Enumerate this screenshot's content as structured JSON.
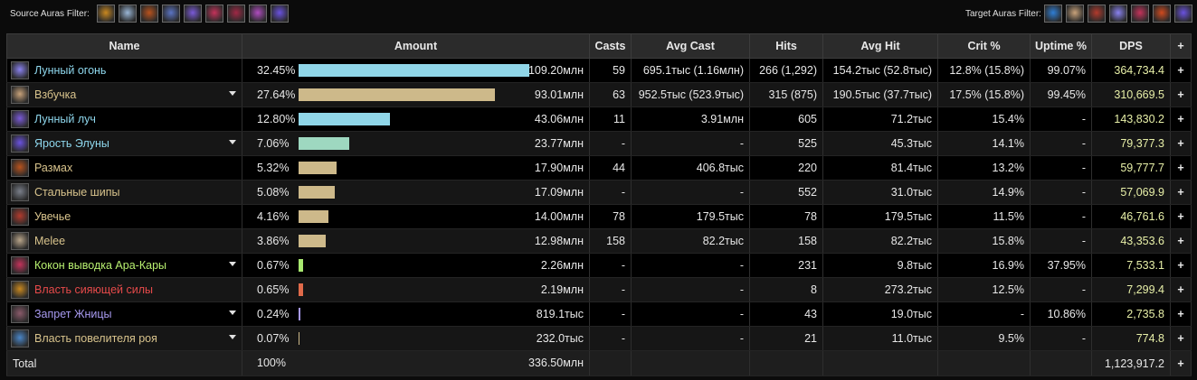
{
  "source_filter": {
    "label": "Source Auras Filter:",
    "icons": [
      {
        "name": "radiant-sun-icon",
        "color": "#c9881f"
      },
      {
        "name": "spirit-face-icon",
        "color": "#9ab6d6"
      },
      {
        "name": "fire-claw-icon",
        "color": "#b8521d"
      },
      {
        "name": "moon-scythe-icon",
        "color": "#5b74c4"
      },
      {
        "name": "purple-beam-icon",
        "color": "#7a5ad8"
      },
      {
        "name": "crimson-flower-icon",
        "color": "#c4325a"
      },
      {
        "name": "crimson-rune-icon",
        "color": "#a02845"
      },
      {
        "name": "violet-orb-icon",
        "color": "#b04cc0"
      },
      {
        "name": "arcane-star-icon",
        "color": "#6a52e0"
      }
    ]
  },
  "target_filter": {
    "label": "Target Auras Filter:",
    "icons": [
      {
        "name": "blue-eye-icon",
        "color": "#2f7fd6"
      },
      {
        "name": "feral-roar-icon",
        "color": "#c8a27a"
      },
      {
        "name": "red-blade-icon",
        "color": "#b23a2c"
      },
      {
        "name": "moonfire-icon",
        "color": "#8a82f0"
      },
      {
        "name": "crimson-flower-icon",
        "color": "#c4325a"
      },
      {
        "name": "demon-mask-icon",
        "color": "#d04a1e"
      },
      {
        "name": "arcane-star-icon",
        "color": "#6a52e0"
      }
    ]
  },
  "headers": {
    "name": "Name",
    "amount": "Amount",
    "casts": "Casts",
    "avg_cast": "Avg Cast",
    "hits": "Hits",
    "avg_hit": "Avg Hit",
    "crit": "Crit %",
    "uptime": "Uptime %",
    "dps": "DPS",
    "plus": "+"
  },
  "max_amount_mln": 109.2,
  "rows": [
    {
      "icon": "moonfire-icon",
      "icon_color": "#8a82f0",
      "name": "Лунный огонь",
      "name_color": "#8fd8ee",
      "expandable": false,
      "percent": "32.45%",
      "amount": "109.20млн",
      "amount_mln": 109.2,
      "bar_color": "#90d6e8",
      "casts": "59",
      "avg_cast": "695.1тыс (1.16млн)",
      "hits": "266 (1,292)",
      "avg_hit": "154.2тыс (52.8тыс)",
      "crit": "12.8% (15.8%)",
      "uptime": "99.07%",
      "dps": "364,734.4",
      "plus": "+"
    },
    {
      "icon": "feral-roar-icon",
      "icon_color": "#c8a27a",
      "name": "Взбучка",
      "name_color": "#d8c38c",
      "expandable": true,
      "percent": "27.64%",
      "amount": "93.01млн",
      "amount_mln": 93.01,
      "bar_color": "#cdb98a",
      "casts": "63",
      "avg_cast": "952.5тыс (523.9тыс)",
      "hits": "315 (875)",
      "avg_hit": "190.5тыс (37.7тыс)",
      "crit": "17.5% (15.8%)",
      "uptime": "99.45%",
      "dps": "310,669.5",
      "plus": "+"
    },
    {
      "icon": "purple-beam-icon",
      "icon_color": "#7a5ad8",
      "name": "Лунный луч",
      "name_color": "#8fd8ee",
      "expandable": false,
      "percent": "12.80%",
      "amount": "43.06млн",
      "amount_mln": 43.06,
      "bar_color": "#90d6e8",
      "casts": "11",
      "avg_cast": "3.91млн",
      "hits": "605",
      "avg_hit": "71.2тыс",
      "crit": "15.4%",
      "uptime": "-",
      "dps": "143,830.2",
      "plus": "+"
    },
    {
      "icon": "arcane-star-icon",
      "icon_color": "#6a52e0",
      "name": "Ярость Элуны",
      "name_color": "#8fd8ee",
      "expandable": true,
      "percent": "7.06%",
      "amount": "23.77млн",
      "amount_mln": 23.77,
      "bar_color": "#9ed8c0",
      "casts": "-",
      "avg_cast": "-",
      "hits": "525",
      "avg_hit": "45.3тыс",
      "crit": "14.1%",
      "uptime": "-",
      "dps": "79,377.3",
      "plus": "+"
    },
    {
      "icon": "fire-claw-icon",
      "icon_color": "#b8521d",
      "name": "Размах",
      "name_color": "#d8c38c",
      "expandable": false,
      "percent": "5.32%",
      "amount": "17.90млн",
      "amount_mln": 17.9,
      "bar_color": "#cdb98a",
      "casts": "44",
      "avg_cast": "406.8тыс",
      "hits": "220",
      "avg_hit": "81.4тыс",
      "crit": "13.2%",
      "uptime": "-",
      "dps": "59,777.7",
      "plus": "+"
    },
    {
      "icon": "moon-scythe-icon",
      "icon_color": "#7a7f8a",
      "name": "Стальные шипы",
      "name_color": "#d8c38c",
      "expandable": false,
      "percent": "5.08%",
      "amount": "17.09млн",
      "amount_mln": 17.09,
      "bar_color": "#cdb98a",
      "casts": "-",
      "avg_cast": "-",
      "hits": "552",
      "avg_hit": "31.0тыс",
      "crit": "14.9%",
      "uptime": "-",
      "dps": "57,069.9",
      "plus": "+"
    },
    {
      "icon": "bleed-slash-icon",
      "icon_color": "#b23a2c",
      "name": "Увечье",
      "name_color": "#d8c38c",
      "expandable": false,
      "percent": "4.16%",
      "amount": "14.00млн",
      "amount_mln": 14.0,
      "bar_color": "#cdb98a",
      "casts": "78",
      "avg_cast": "179.5тыс",
      "hits": "78",
      "avg_hit": "179.5тыс",
      "crit": "11.5%",
      "uptime": "-",
      "dps": "46,761.6",
      "plus": "+"
    },
    {
      "icon": "paw-swipe-icon",
      "icon_color": "#b9a58a",
      "name": "Melee",
      "name_color": "#d8c38c",
      "expandable": false,
      "percent": "3.86%",
      "amount": "12.98млн",
      "amount_mln": 12.98,
      "bar_color": "#cdb98a",
      "casts": "158",
      "avg_cast": "82.2тыс",
      "hits": "158",
      "avg_hit": "82.2тыс",
      "crit": "15.8%",
      "uptime": "-",
      "dps": "43,353.6",
      "plus": "+"
    },
    {
      "icon": "crimson-flower-icon",
      "icon_color": "#c4325a",
      "name": "Кокон выводка Ара-Кары",
      "name_color": "#b8f070",
      "expandable": true,
      "percent": "0.67%",
      "amount": "2.26млн",
      "amount_mln": 2.26,
      "bar_color": "#a8e870",
      "casts": "-",
      "avg_cast": "-",
      "hits": "231",
      "avg_hit": "9.8тыс",
      "crit": "16.9%",
      "uptime": "37.95%",
      "dps": "7,533.1",
      "plus": "+"
    },
    {
      "icon": "radiant-sun-icon",
      "icon_color": "#c9881f",
      "name": "Власть сияющей силы",
      "name_color": "#e64a4a",
      "expandable": false,
      "percent": "0.65%",
      "amount": "2.19млн",
      "amount_mln": 2.19,
      "bar_color": "#e06a4a",
      "casts": "-",
      "avg_cast": "-",
      "hits": "8",
      "avg_hit": "273.2тыс",
      "crit": "12.5%",
      "uptime": "-",
      "dps": "7,299.4",
      "plus": "+"
    },
    {
      "icon": "red-blade-icon",
      "icon_color": "#8a5a6a",
      "name": "Запрет Жницы",
      "name_color": "#a89af0",
      "expandable": true,
      "percent": "0.24%",
      "amount": "819.1тыс",
      "amount_mln": 0.8191,
      "bar_color": "#a89af0",
      "casts": "-",
      "avg_cast": "-",
      "hits": "43",
      "avg_hit": "19.0тыс",
      "crit": "-",
      "uptime": "10.86%",
      "dps": "2,735.8",
      "plus": "+"
    },
    {
      "icon": "swarm-gem-icon",
      "icon_color": "#4a86c8",
      "name": "Власть повелителя роя",
      "name_color": "#d8c38c",
      "expandable": true,
      "percent": "0.07%",
      "amount": "232.0тыс",
      "amount_mln": 0.232,
      "bar_color": "#cdb98a",
      "casts": "-",
      "avg_cast": "-",
      "hits": "21",
      "avg_hit": "11.0тыс",
      "crit": "9.5%",
      "uptime": "-",
      "dps": "774.8",
      "plus": "+"
    }
  ],
  "total": {
    "label": "Total",
    "percent": "100%",
    "amount": "336.50млн",
    "dps": "1,123,917.2",
    "plus": "+"
  }
}
